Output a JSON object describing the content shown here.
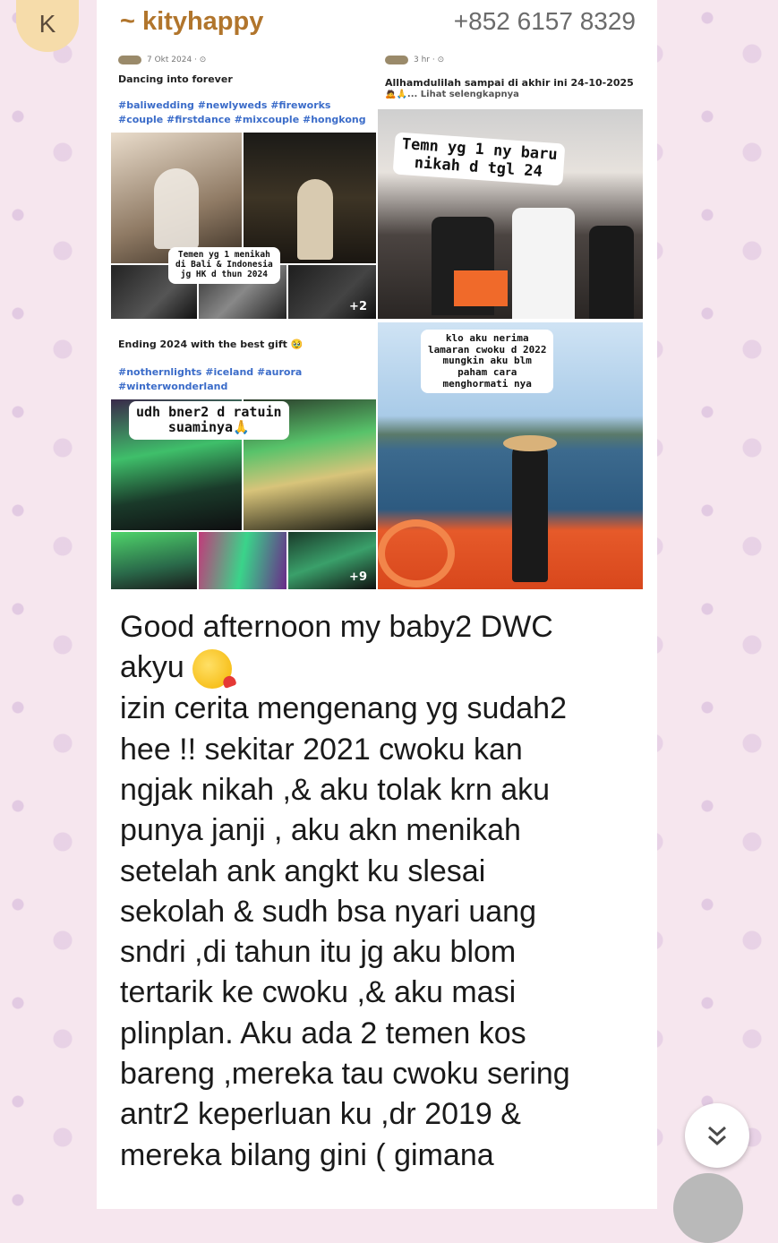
{
  "chat": {
    "avatar_letter": "K",
    "sender_name": "~ kityhappy",
    "sender_phone": "+852 6157 8329"
  },
  "collage": {
    "post1": {
      "date": "7 Okt 2024 · ⊙",
      "caption": "Dancing into forever",
      "tags_line1": "#baliwedding #newlyweds #fireworks",
      "tags_line2": "#couple #firstdance #mixcouple #hongkong",
      "overlay": "Temen yg 1 menikah\ndi Bali & Indonesia\njg HK d thun 2024",
      "more_count": "+2"
    },
    "post2": {
      "date": "3 hr · ⊙",
      "caption": "Allhamdulilah sampai di akhir ini 24-10-2025",
      "caption2": "🙇🙏... Lihat selengkapnya",
      "overlay": "Temn yg 1 ny baru\nnikah d tgl 24"
    },
    "post3": {
      "caption": "Ending 2024 with the best gift 🥹",
      "tags_line1": "#nothernlights #iceland #aurora",
      "tags_line2": "#winterwonderland",
      "overlay": "udh bner2 d ratuin\nsuaminya🙏",
      "more_count": "+9"
    },
    "post4": {
      "overlay": "klo aku nerima\nlamaran cwoku d 2022\nmungkin aku blm\npaham cara\nmenghormati nya"
    }
  },
  "message": {
    "line1": "Good afternoon my baby2 DWC",
    "line2": "akyu",
    "body": "izin cerita mengenang yg sudah2\nhee !! sekitar 2021 cwoku kan\nngjak nikah ,& aku tolak krn aku\npunya janji , aku akn menikah\nsetelah ank angkt ku slesai\nsekolah & sudh bsa nyari uang\nsndri ,di tahun itu jg aku blom\ntertarik ke cwoku ,& aku masi\nplinplan. Aku ada 2 temen kos\nbareng ,mereka tau cwoku sering\nantr2 keperluan ku ,dr 2019 &\nmereka bilang gini ( gimana"
  },
  "icons": {
    "emoji": "kissing-face-with-heart-emoji",
    "scroll": "double-chevron-down-icon"
  }
}
